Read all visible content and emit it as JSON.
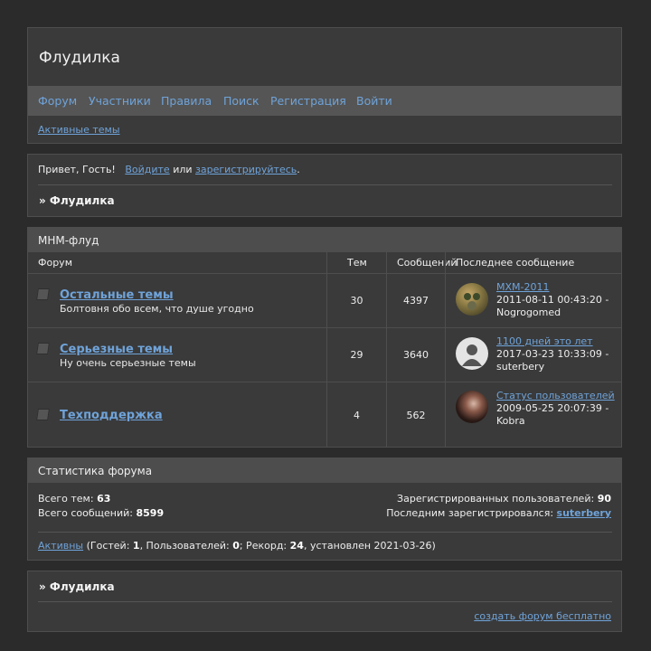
{
  "site": {
    "title": "Флудилка",
    "nav": [
      "Форум",
      "Участники",
      "Правила",
      "Поиск",
      "Регистрация",
      "Войти"
    ],
    "active_topics": "Активные темы"
  },
  "welcome": {
    "greeting": "Привет, Гость!",
    "login": "Войдите",
    "or": "или",
    "register": "зарегистрируйтесь",
    "dot": ".",
    "breadcrumb": "» Флудилка"
  },
  "forums": {
    "category": "МНМ-флуд",
    "headers": {
      "forum": "Форум",
      "topics": "Тем",
      "posts": "Сообщений",
      "last": "Последнее сообщение"
    },
    "rows": [
      {
        "name": "Остальные темы",
        "desc": "Болтовня обо всем, что душе угодно",
        "topics": "30",
        "posts": "4397",
        "last_title": "МХМ-2011",
        "last_time": "2011-08-11 00:43:20 -",
        "last_user": "Nogrogomed"
      },
      {
        "name": "Серьезные темы",
        "desc": "Ну очень серьезные темы",
        "topics": "29",
        "posts": "3640",
        "last_title": "1100 дней это лет",
        "last_time": "2017-03-23 10:33:09 -",
        "last_user": "suterbery"
      },
      {
        "name": "Техподдержка",
        "desc": "",
        "topics": "4",
        "posts": "562",
        "last_title": "Статус пользователей",
        "last_time": "2009-05-25 20:07:39 -",
        "last_user": "Kobra"
      }
    ]
  },
  "stats": {
    "title": "Статистика форума",
    "topics_label": "Всего тем:",
    "topics": "63",
    "posts_label": "Всего сообщений:",
    "posts": "8599",
    "users_label": "Зарегистрированных пользователей:",
    "users": "90",
    "last_reg_label": "Последним зарегистрировался:",
    "last_reg": "suterbery",
    "active": "Активны",
    "guests_label": "(Гостей:",
    "guests": "1",
    "members_label": ", Пользователей:",
    "members": "0",
    "record_label": "; Рекорд:",
    "record": "24",
    "record_date": ", установлен 2021-03-26)"
  },
  "footer": {
    "breadcrumb": "» Флудилка",
    "create": "создать форум бесплатно"
  }
}
